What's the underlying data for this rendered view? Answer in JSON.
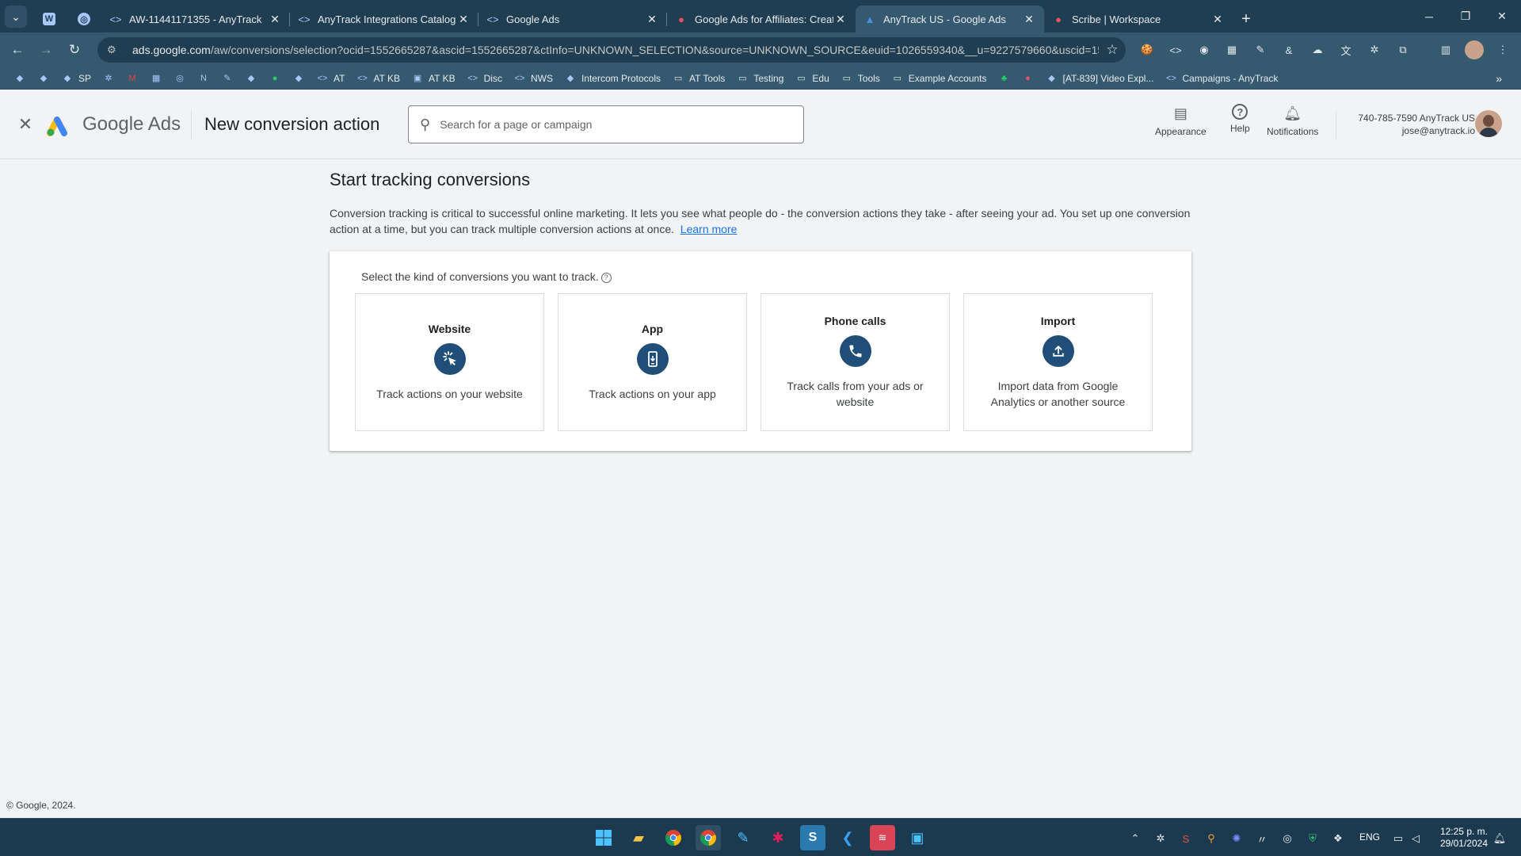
{
  "browser": {
    "tabs": [
      {
        "title": "AW-11441171355 - AnyTrack",
        "icon": "code-bracket-icon"
      },
      {
        "title": "AnyTrack Integrations Catalog",
        "icon": "code-bracket-icon"
      },
      {
        "title": "Google Ads",
        "icon": "code-bracket-icon"
      },
      {
        "title": "Google Ads for Affiliates: Creat",
        "icon": "scribe-icon"
      },
      {
        "title": "AnyTrack US - Google Ads",
        "icon": "google-ads-icon",
        "active": true
      },
      {
        "title": "Scribe | Workspace",
        "icon": "scribe-icon"
      }
    ],
    "url_domain": "ads.google.com",
    "url_path": "/aw/conversions/selection?ocid=1552665287&ascid=1552665287&ctInfo=UNKNOWN_SELECTION&source=UNKNOWN_SOURCE&euid=1026559340&__u=9227579660&uscid=155...",
    "bookmarks": [
      {
        "label": "",
        "icon": "app-icon"
      },
      {
        "label": "",
        "icon": "app-icon"
      },
      {
        "label": "SP",
        "icon": "app-icon"
      },
      {
        "label": "",
        "icon": "gear-icon"
      },
      {
        "label": "",
        "icon": "gmail-icon"
      },
      {
        "label": "",
        "icon": "calendar-icon"
      },
      {
        "label": "",
        "icon": "chatgpt-icon"
      },
      {
        "label": "",
        "icon": "notion-icon"
      },
      {
        "label": "",
        "icon": "pen-icon"
      },
      {
        "label": "",
        "icon": "app-icon"
      },
      {
        "label": "",
        "icon": "spotify-icon"
      },
      {
        "label": "",
        "icon": "app-icon"
      },
      {
        "label": "AT",
        "icon": "code-bracket-icon"
      },
      {
        "label": "AT KB",
        "icon": "code-bracket-icon"
      },
      {
        "label": "AT KB",
        "icon": "book-icon"
      },
      {
        "label": "Disc",
        "icon": "code-bracket-icon"
      },
      {
        "label": "NWS",
        "icon": "code-bracket-icon"
      },
      {
        "label": "Intercom Protocols",
        "icon": "app-icon"
      },
      {
        "label": "AT Tools",
        "icon": "folder-icon"
      },
      {
        "label": "Testing",
        "icon": "folder-icon"
      },
      {
        "label": "Edu",
        "icon": "folder-icon"
      },
      {
        "label": "Tools",
        "icon": "folder-icon"
      },
      {
        "label": "Example Accounts",
        "icon": "folder-icon"
      },
      {
        "label": "",
        "icon": "leaf-icon"
      },
      {
        "label": "",
        "icon": "scribe-icon"
      },
      {
        "label": "[AT-839] Video Expl...",
        "icon": "app-icon"
      },
      {
        "label": "Campaigns - AnyTrack",
        "icon": "code-bracket-icon"
      }
    ]
  },
  "header": {
    "brand_google": "Google",
    "brand_ads": "Ads",
    "page_title": "New conversion action",
    "search_placeholder": "Search for a page or campaign",
    "appearance_label": "Appearance",
    "help_label": "Help",
    "notifications_label": "Notifications",
    "account_name": "740-785-7590 AnyTrack US",
    "account_email": "jose@anytrack.io"
  },
  "main": {
    "heading": "Start tracking conversions",
    "description": "Conversion tracking is critical to successful online marketing. It lets you see what people do - the conversion actions they take - after seeing your ad. You set up one conversion action at a time, but you can track multiple conversion actions at once.",
    "learn_more": "Learn more",
    "prompt": "Select the kind of conversions you want to track.",
    "options": [
      {
        "label": "Website",
        "description": "Track actions on your website",
        "icon": "click-cursor-icon"
      },
      {
        "label": "App",
        "description": "Track actions on your app",
        "icon": "mobile-app-icon"
      },
      {
        "label": "Phone calls",
        "description": "Track calls from your ads or website",
        "icon": "phone-icon"
      },
      {
        "label": "Import",
        "description": "Import data from Google Analytics or another source",
        "icon": "upload-icon"
      }
    ]
  },
  "footer": {
    "copyright": "© Google, 2024."
  },
  "taskbar": {
    "language": "ENG",
    "time": "12:25 p. m.",
    "date": "29/01/2024"
  },
  "colors": {
    "accent": "#1a73e8",
    "option_icon_bg": "#1f4f78",
    "chrome_frame": "#1f3e51",
    "chrome_toolbar": "#35596f"
  }
}
